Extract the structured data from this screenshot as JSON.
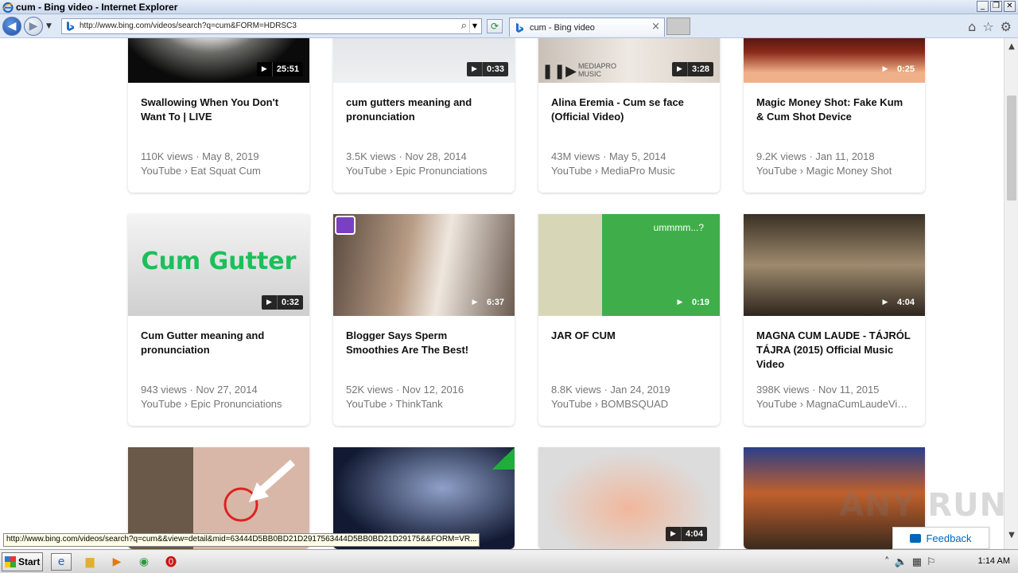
{
  "window": {
    "title": "cum - Bing video - Internet Explorer",
    "controls": [
      "_",
      "❐",
      "✕"
    ]
  },
  "nav": {
    "url": "http://www.bing.com/videos/search?q=cum&FORM=HDRSC3",
    "tab_label": "cum - Bing video"
  },
  "videos": [
    {
      "title": "Swallowing When You Don't Want To | LIVE",
      "duration": "25:51",
      "views_date": "110K views · May 8, 2019",
      "source": "YouTube › Eat Squat Cum"
    },
    {
      "title": "cum gutters meaning and pronunciation",
      "duration": "0:33",
      "views_date": "3.5K views · Nov 28, 2014",
      "source": "YouTube › Epic Pronunciations"
    },
    {
      "title": "Alina Eremia - Cum se face (Official Video)",
      "duration": "3:28",
      "views_date": "43M views · May 5, 2014",
      "source": "YouTube › MediaPro Music",
      "overlay": "MEDIAPRO MUSIC"
    },
    {
      "title": "Magic Money Shot: Fake Kum & Cum Shot Device",
      "duration": "0:25",
      "views_date": "9.2K views · Jan 11, 2018",
      "source": "YouTube › Magic Money Shot"
    },
    {
      "title": "Cum Gutter meaning and pronunciation",
      "duration": "0:32",
      "views_date": "943 views · Nov 27, 2014",
      "source": "YouTube › Epic Pronunciations",
      "thumb_text": "Cum Gutter"
    },
    {
      "title": "Blogger Says Sperm Smoothies Are The Best!",
      "duration": "6:37",
      "views_date": "52K views · Nov 12, 2016",
      "source": "YouTube › ThinkTank"
    },
    {
      "title": "JAR OF CUM",
      "duration": "0:19",
      "views_date": "8.8K views · Jan 24, 2019",
      "source": "YouTube › BOMBSQUAD",
      "overlay": "ummmm...?"
    },
    {
      "title": "MAGNA CUM LAUDE - TÁJRÓL TÁJRA (2015) Official Music Video",
      "duration": "4:04",
      "views_date": "398K views · Nov 11, 2015",
      "source": "YouTube › MagnaCumLaudeVi…"
    },
    {
      "title": "",
      "duration": "",
      "views_date": "",
      "source": ""
    },
    {
      "title": "",
      "duration": "",
      "views_date": "",
      "source": ""
    },
    {
      "title": "",
      "duration": "4:04",
      "views_date": "",
      "source": ""
    },
    {
      "title": "",
      "duration": "",
      "views_date": "",
      "source": ""
    }
  ],
  "status_url": "http://www.bing.com/videos/search?q=cum&&view=detail&mid=63444D5BB0BD21D2917563444D5BB0BD21D29175&&FORM=VR...",
  "feedback_label": "Feedback",
  "watermark": "ANY RUN",
  "taskbar": {
    "start_label": "Start",
    "clock": "1:14 AM"
  }
}
